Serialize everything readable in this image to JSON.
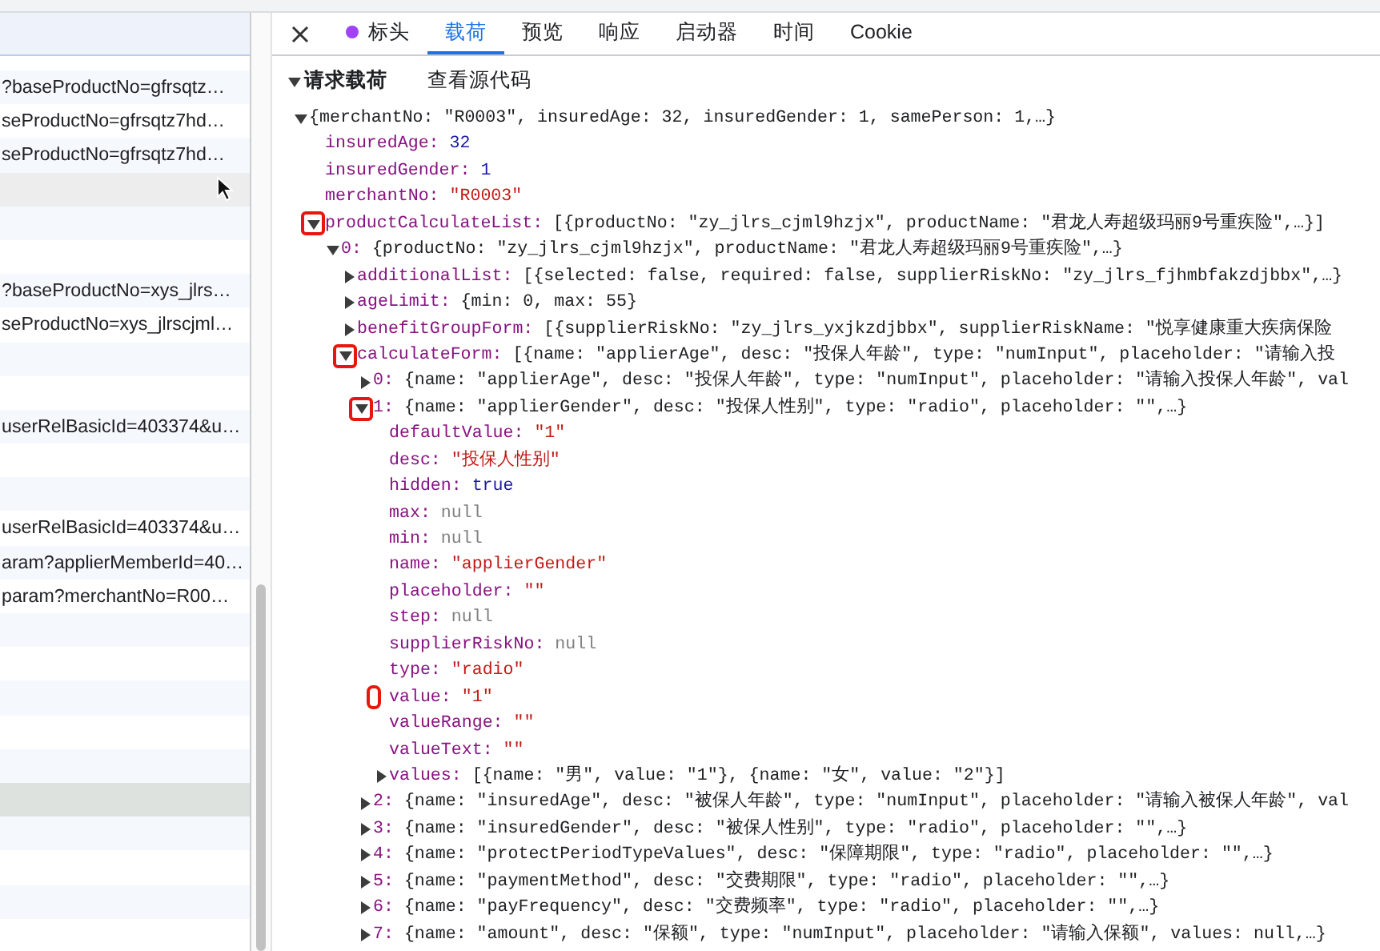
{
  "request_list": {
    "rows": [
      {
        "text": "?baseProductNo=gfrsqtz…",
        "selected": false,
        "hovered": false
      },
      {
        "text": "seProductNo=gfrsqtz7hd…",
        "selected": false,
        "hovered": false
      },
      {
        "text": "seProductNo=gfrsqtz7hd…",
        "selected": false,
        "hovered": false
      },
      {
        "text": "",
        "selected": false,
        "hovered": true
      },
      {
        "text": "",
        "selected": false,
        "hovered": false
      },
      {
        "text": "",
        "selected": false,
        "hovered": false
      },
      {
        "text": "?baseProductNo=xys_jlrs…",
        "selected": false,
        "hovered": false
      },
      {
        "text": "seProductNo=xys_jlrscjml…",
        "selected": false,
        "hovered": false
      },
      {
        "text": "",
        "selected": false,
        "hovered": false
      },
      {
        "text": "",
        "selected": false,
        "hovered": false
      },
      {
        "text": "userRelBasicId=403374&u…",
        "selected": false,
        "hovered": false
      },
      {
        "text": "",
        "selected": false,
        "hovered": false
      },
      {
        "text": "",
        "selected": false,
        "hovered": false
      },
      {
        "text": "userRelBasicId=403374&u…",
        "selected": false,
        "hovered": false
      },
      {
        "text": "aram?applierMemberId=40…",
        "selected": false,
        "hovered": false
      },
      {
        "text": "param?merchantNo=R00…",
        "selected": false,
        "hovered": false
      },
      {
        "text": "",
        "selected": false,
        "hovered": false
      },
      {
        "text": "",
        "selected": false,
        "hovered": false
      },
      {
        "text": "",
        "selected": false,
        "hovered": false
      },
      {
        "text": "",
        "selected": false,
        "hovered": false
      },
      {
        "text": "",
        "selected": false,
        "hovered": false
      },
      {
        "text": "",
        "selected": true,
        "hovered": false
      },
      {
        "text": "",
        "selected": false,
        "hovered": false
      },
      {
        "text": "",
        "selected": false,
        "hovered": false
      },
      {
        "text": "",
        "selected": false,
        "hovered": false
      },
      {
        "text": "",
        "selected": false,
        "hovered": false
      }
    ]
  },
  "detail_tabs": [
    {
      "label": "标头",
      "selected": false,
      "dot": true
    },
    {
      "label": "载荷",
      "selected": true,
      "dot": false
    },
    {
      "label": "预览",
      "selected": false,
      "dot": false
    },
    {
      "label": "响应",
      "selected": false,
      "dot": false
    },
    {
      "label": "启动器",
      "selected": false,
      "dot": false
    },
    {
      "label": "时间",
      "selected": false,
      "dot": false
    },
    {
      "label": "Cookie",
      "selected": false,
      "dot": false
    }
  ],
  "payload": {
    "section_title": "请求载荷",
    "expanded": true,
    "view_source_label": "查看源代码",
    "tree": [
      {
        "value": "{merchantNo: \"R0003\", insuredAge: 32, insuredGender: 1, samePerson: 1,…}",
        "kind": "preview",
        "expanded": true,
        "annotated": false,
        "children": [
          {
            "key": "insuredAge:",
            "value": "32",
            "kind": "number",
            "annotated": false
          },
          {
            "key": "insuredGender:",
            "value": "1",
            "kind": "number",
            "annotated": false
          },
          {
            "key": "merchantNo:",
            "value": "\"R0003\"",
            "kind": "string",
            "annotated": false
          },
          {
            "key": "productCalculateList:",
            "value": "[{productNo: \"zy_jlrs_cjml9hzjx\", productName: \"君龙人寿超级玛丽9号重疾险\",…}]",
            "kind": "preview",
            "expanded": true,
            "annotated": true,
            "children": [
              {
                "key": "0:",
                "value": "{productNo: \"zy_jlrs_cjml9hzjx\", productName: \"君龙人寿超级玛丽9号重疾险\",…}",
                "kind": "preview",
                "expanded": true,
                "annotated": false,
                "children": [
                  {
                    "key": "additionalList:",
                    "value": "[{selected: false, required: false, supplierRiskNo: \"zy_jlrs_fjhmbfakzdjbbx\",…}",
                    "kind": "preview",
                    "expanded": false,
                    "annotated": false
                  },
                  {
                    "key": "ageLimit:",
                    "value": "{min: 0, max: 55}",
                    "kind": "preview",
                    "expanded": false,
                    "annotated": false
                  },
                  {
                    "key": "benefitGroupForm:",
                    "value": "[{supplierRiskNo: \"zy_jlrs_yxjkzdjbbx\", supplierRiskName: \"悦享健康重大疾病保险",
                    "kind": "preview",
                    "expanded": false,
                    "annotated": false
                  },
                  {
                    "key": "calculateForm:",
                    "value": "[{name: \"applierAge\", desc: \"投保人年龄\", type: \"numInput\", placeholder: \"请输入投",
                    "kind": "preview",
                    "expanded": true,
                    "annotated": true,
                    "children": [
                      {
                        "key": "0:",
                        "value": "{name: \"applierAge\", desc: \"投保人年龄\", type: \"numInput\", placeholder: \"请输入投保人年龄\", val",
                        "kind": "preview",
                        "expanded": false,
                        "annotated": false
                      },
                      {
                        "key": "1:",
                        "value": "{name: \"applierGender\", desc: \"投保人性别\", type: \"radio\", placeholder: \"\",…}",
                        "kind": "preview",
                        "expanded": true,
                        "annotated": true,
                        "children": [
                          {
                            "key": "defaultValue:",
                            "value": "\"1\"",
                            "kind": "string",
                            "annotated": false
                          },
                          {
                            "key": "desc:",
                            "value": "\"投保人性别\"",
                            "kind": "string",
                            "annotated": false
                          },
                          {
                            "key": "hidden:",
                            "value": "true",
                            "kind": "boolean",
                            "annotated": false
                          },
                          {
                            "key": "max:",
                            "value": "null",
                            "kind": "null",
                            "annotated": false
                          },
                          {
                            "key": "min:",
                            "value": "null",
                            "kind": "null",
                            "annotated": false
                          },
                          {
                            "key": "name:",
                            "value": "\"applierGender\"",
                            "kind": "string",
                            "annotated": false
                          },
                          {
                            "key": "placeholder:",
                            "value": "\"\"",
                            "kind": "string",
                            "annotated": false
                          },
                          {
                            "key": "step:",
                            "value": "null",
                            "kind": "null",
                            "annotated": false
                          },
                          {
                            "key": "supplierRiskNo:",
                            "value": "null",
                            "kind": "null",
                            "annotated": false
                          },
                          {
                            "key": "type:",
                            "value": "\"radio\"",
                            "kind": "string",
                            "annotated": false
                          },
                          {
                            "key": "value:",
                            "value": "\"1\"",
                            "kind": "string",
                            "annotated": true
                          },
                          {
                            "key": "valueRange:",
                            "value": "\"\"",
                            "kind": "string",
                            "annotated": false
                          },
                          {
                            "key": "valueText:",
                            "value": "\"\"",
                            "kind": "string",
                            "annotated": false
                          },
                          {
                            "key": "values:",
                            "value": "[{name: \"男\", value: \"1\"}, {name: \"女\", value: \"2\"}]",
                            "kind": "preview",
                            "expanded": false,
                            "annotated": false
                          }
                        ]
                      },
                      {
                        "key": "2:",
                        "value": "{name: \"insuredAge\", desc: \"被保人年龄\", type: \"numInput\", placeholder: \"请输入被保人年龄\", val",
                        "kind": "preview",
                        "expanded": false,
                        "annotated": false
                      },
                      {
                        "key": "3:",
                        "value": "{name: \"insuredGender\", desc: \"被保人性别\", type: \"radio\", placeholder: \"\",…}",
                        "kind": "preview",
                        "expanded": false,
                        "annotated": false
                      },
                      {
                        "key": "4:",
                        "value": "{name: \"protectPeriodTypeValues\", desc: \"保障期限\", type: \"radio\", placeholder: \"\",…}",
                        "kind": "preview",
                        "expanded": false,
                        "annotated": false
                      },
                      {
                        "key": "5:",
                        "value": "{name: \"paymentMethod\", desc: \"交费期限\", type: \"radio\", placeholder: \"\",…}",
                        "kind": "preview",
                        "expanded": false,
                        "annotated": false
                      },
                      {
                        "key": "6:",
                        "value": "{name: \"payFrequency\", desc: \"交费频率\", type: \"radio\", placeholder: \"\",…}",
                        "kind": "preview",
                        "expanded": false,
                        "annotated": false
                      },
                      {
                        "key": "7:",
                        "value": "{name: \"amount\", desc: \"保额\", type: \"numInput\", placeholder: \"请输入保额\", values: null,…}",
                        "kind": "preview",
                        "expanded": false,
                        "annotated": false
                      }
                    ]
                  }
                ]
              }
            ]
          }
        ]
      }
    ]
  }
}
